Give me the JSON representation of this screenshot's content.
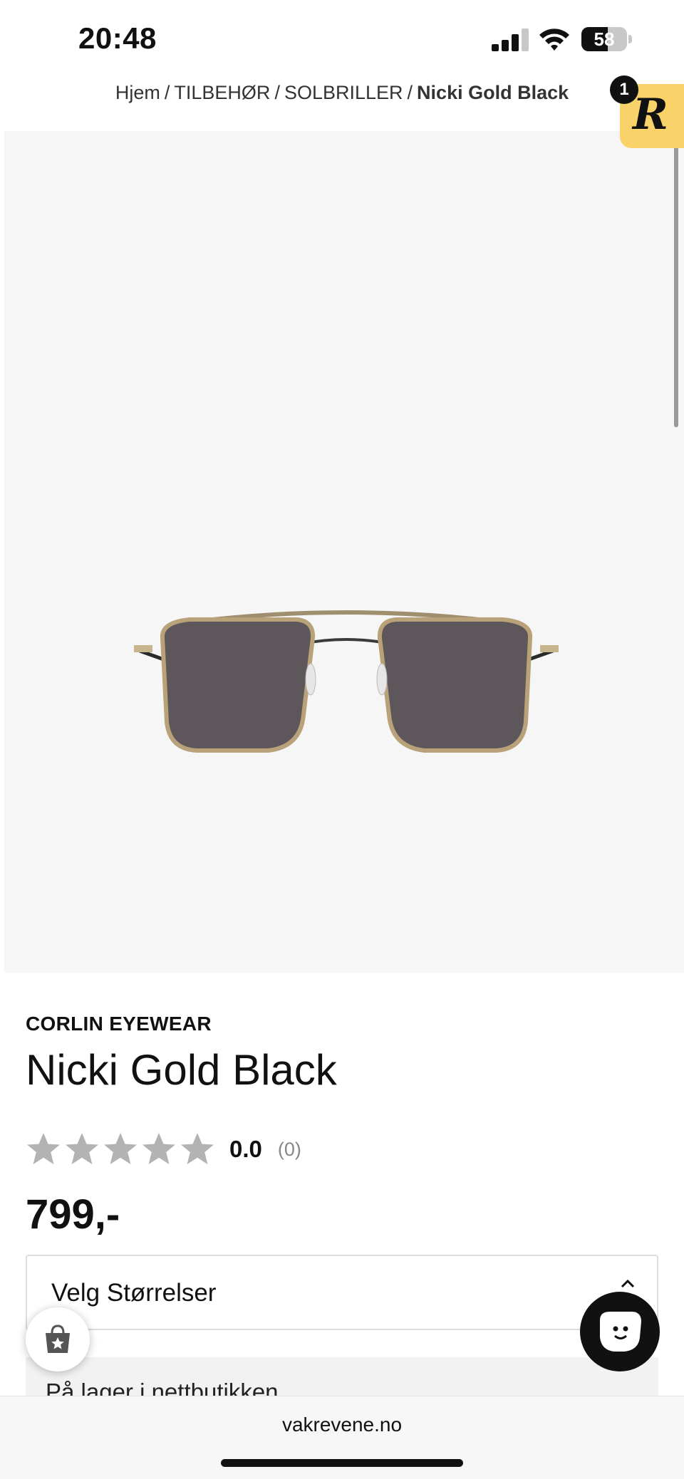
{
  "status_bar": {
    "time": "20:48",
    "battery_percent": "58",
    "battery_level": 0.58,
    "signal_icon": "cellular-signal-icon",
    "wifi_icon": "wifi-icon",
    "battery_icon": "battery-icon"
  },
  "breadcrumb": {
    "items": [
      "Hjem",
      "TILBEHØR",
      "SOLBRILLER"
    ],
    "current": "Nicki Gold Black",
    "separator": "/"
  },
  "rewards": {
    "letter": "R",
    "count": "1",
    "color": "#f9d26a"
  },
  "product": {
    "image_icon": "sunglasses-image",
    "brand": "CORLIN EYEWEAR",
    "title": "Nicki Gold Black",
    "rating_value": "0.0",
    "rating_count": "(0)",
    "stars_filled": 0,
    "stars_total": 5,
    "price": "799,-"
  },
  "size_selector": {
    "label": "Velg Størrelser",
    "icon": "chevron-up-icon"
  },
  "stock": {
    "label": "På lager i nettbutikken"
  },
  "floating": {
    "wishlist_icon": "shopping-bag-star-icon",
    "chat_icon": "chat-face-icon"
  },
  "browser": {
    "url": "vakrevene.no"
  },
  "colors": {
    "star_empty": "#b3b3b3",
    "image_bg": "#f6f6f6",
    "lens": "#5d575b",
    "frame_gold": "#b9a27a"
  }
}
